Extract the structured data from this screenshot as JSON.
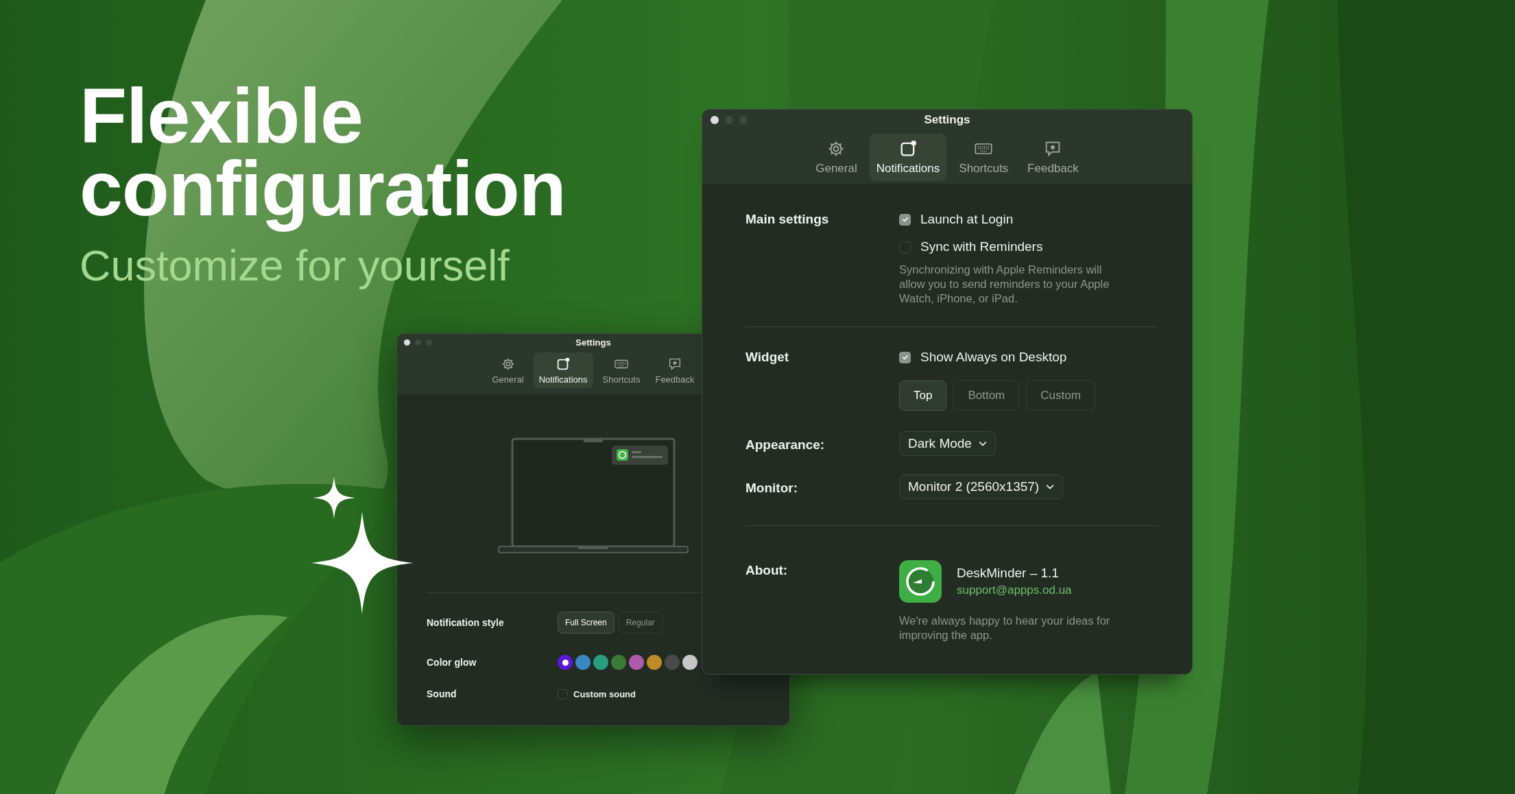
{
  "hero": {
    "title_lines": [
      "Flexible",
      "configuration"
    ],
    "subtitle": "Customize for yourself"
  },
  "back_window": {
    "title": "Settings",
    "tabs": [
      {
        "label": "General",
        "kind": "gear",
        "selected": false
      },
      {
        "label": "Notifications",
        "kind": "notification",
        "selected": true
      },
      {
        "label": "Shortcuts",
        "kind": "keyboard",
        "selected": false
      },
      {
        "label": "Feedback",
        "kind": "feedback",
        "selected": false
      }
    ],
    "notification_style": {
      "label": "Notification style",
      "options": [
        {
          "label": "Full Screen",
          "selected": true
        },
        {
          "label": "Regular",
          "selected": false
        }
      ]
    },
    "color_glow": {
      "label": "Color glow",
      "swatches": [
        {
          "color": "#5b18d8",
          "selected": true
        },
        {
          "color": "#3a88c0",
          "selected": false
        },
        {
          "color": "#2a9d80",
          "selected": false
        },
        {
          "color": "#3c7a3a",
          "selected": false
        },
        {
          "color": "#b05aac",
          "selected": false
        },
        {
          "color": "#c08a28",
          "selected": false
        },
        {
          "color": "#4a4a4a",
          "selected": false
        },
        {
          "color": "#c8c8c8",
          "selected": false
        }
      ]
    },
    "sound": {
      "label": "Sound",
      "option": {
        "label": "Custom sound",
        "checked": false
      }
    }
  },
  "front_window": {
    "title": "Settings",
    "tabs": [
      {
        "label": "General",
        "kind": "gear",
        "selected": false
      },
      {
        "label": "Notifications",
        "kind": "notification",
        "selected": true
      },
      {
        "label": "Shortcuts",
        "kind": "keyboard",
        "selected": false
      },
      {
        "label": "Feedback",
        "kind": "feedback",
        "selected": false
      }
    ],
    "main_settings": {
      "label": "Main settings",
      "options": [
        {
          "label": "Launch at Login",
          "checked": true
        },
        {
          "label": "Sync with Reminders",
          "checked": false
        }
      ],
      "note": "Synchronizing with Apple Reminders will allow you to send reminders to your Apple Watch, iPhone, or iPad."
    },
    "widget": {
      "label": "Widget",
      "option": {
        "label": "Show Always on Desktop",
        "checked": true
      },
      "positions": [
        {
          "label": "Top",
          "selected": true
        },
        {
          "label": "Bottom",
          "selected": false
        },
        {
          "label": "Custom",
          "selected": false
        }
      ]
    },
    "appearance": {
      "label": "Appearance:",
      "value": "Dark Mode"
    },
    "monitor": {
      "label": "Monitor:",
      "value": "Monitor 2 (2560x1357)"
    },
    "about": {
      "label": "About:",
      "app_name": "DeskMinder – 1.1",
      "email": "support@appps.od.ua",
      "note": "We're always happy to hear your ideas for improving the app."
    }
  }
}
